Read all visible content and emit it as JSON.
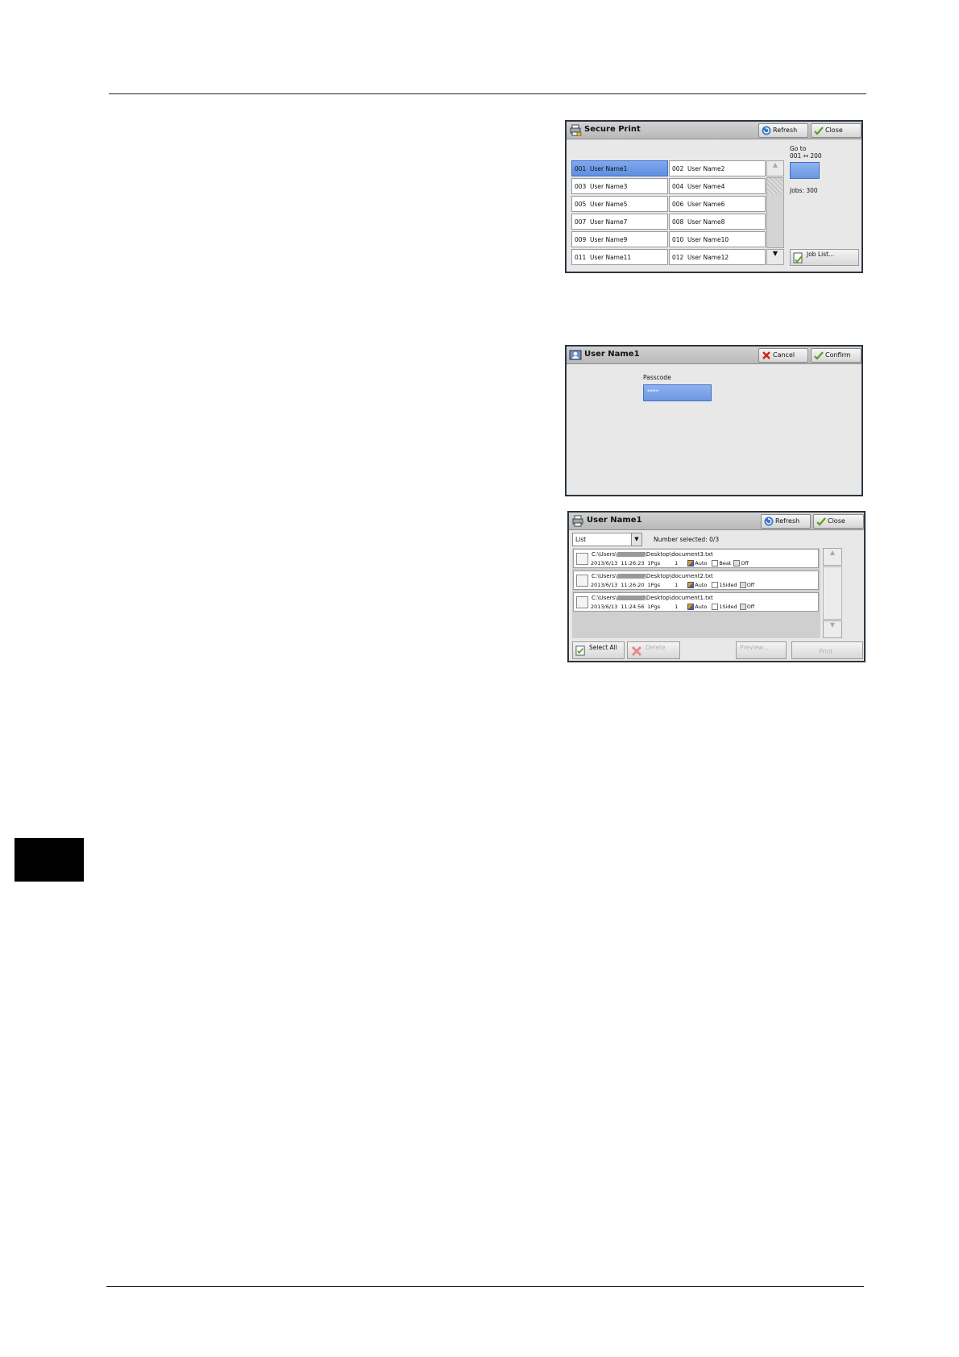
{
  "panel1": {
    "title": "Secure Print",
    "refresh_label": "Refresh",
    "close_label": "Close",
    "goto_label": "Go to",
    "goto_range": "001 ↔ 200",
    "jobs_label": "Jobs: 300",
    "job_list_label": "Job List...",
    "users": [
      {
        "num": "001",
        "name": "User Name1"
      },
      {
        "num": "002",
        "name": "User Name2"
      },
      {
        "num": "003",
        "name": "User Name3"
      },
      {
        "num": "004",
        "name": "User Name4"
      },
      {
        "num": "005",
        "name": "User Name5"
      },
      {
        "num": "006",
        "name": "User Name6"
      },
      {
        "num": "007",
        "name": "User Name7"
      },
      {
        "num": "008",
        "name": "User Name8"
      },
      {
        "num": "009",
        "name": "User Name9"
      },
      {
        "num": "010",
        "name": "User Name10"
      },
      {
        "num": "011",
        "name": "User Name11"
      },
      {
        "num": "012",
        "name": "User Name12"
      }
    ],
    "selected_user": "001"
  },
  "panel2": {
    "title": "User Name1",
    "cancel_label": "Cancel",
    "confirm_label": "Confirm",
    "passcode_label": "Passcode",
    "passcode_value": "****"
  },
  "panel3": {
    "title": "User Name1",
    "refresh_label": "Refresh",
    "close_label": "Close",
    "view_select": "List",
    "number_selected": "Number selected: 0/3",
    "files": [
      {
        "path_prefix": "C:\\Users\\",
        "path_suffix": "\\Desktop\\document3.txt",
        "date": "2013/6/13",
        "time": "11:26:23",
        "pages": "1Pgs",
        "copies": "1",
        "color": "Auto",
        "sides": "Beat",
        "staple": "Off"
      },
      {
        "path_prefix": "C:\\Users\\",
        "path_suffix": "\\Desktop\\document2.txt",
        "date": "2013/6/13",
        "time": "11:26:20",
        "pages": "1Pgs",
        "copies": "1",
        "color": "Auto",
        "sides": "1Sided",
        "staple": "Off"
      },
      {
        "path_prefix": "C:\\Users\\",
        "path_suffix": "\\Desktop\\document1.txt",
        "date": "2013/6/13",
        "time": "11:24:56",
        "pages": "1Pgs",
        "copies": "1",
        "color": "Auto",
        "sides": "1Sided",
        "staple": "Off"
      }
    ],
    "select_all_label": "Select All",
    "delete_label": "Delete",
    "preview_label": "Preview...",
    "print_label": "Print"
  },
  "colors": {
    "selected_cell": "#6f9be8",
    "panel_border": "#2a3540",
    "panel_bg": "#e8e8e8"
  }
}
